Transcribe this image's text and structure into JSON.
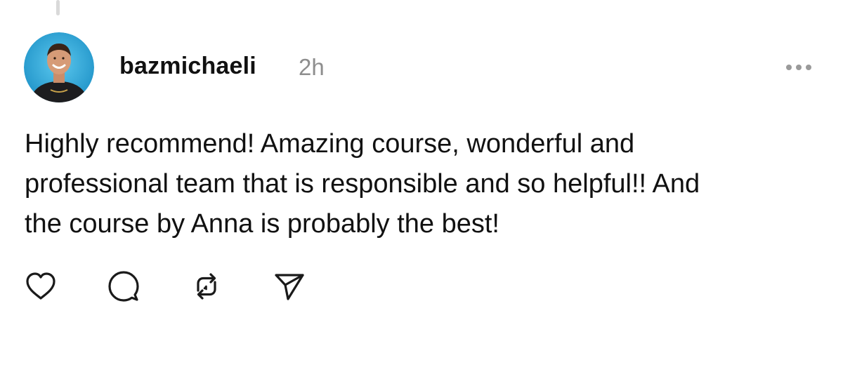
{
  "post": {
    "username": "bazmichaeli",
    "timestamp": "2h",
    "text_lines": [
      "Highly recommend! Amazing course, wonderful and",
      "professional team that is responsible and so helpful!! And",
      "the course by Anna is probably the best!"
    ]
  },
  "icons": {
    "more": "more-horizontal-icon",
    "like": "heart-icon",
    "reply": "comment-bubble-icon",
    "repost": "repost-arrows-icon",
    "share": "send-paper-plane-icon"
  },
  "colors": {
    "text": "#111111",
    "muted": "#8e8e8e",
    "avatar_bg": "#2aa6d9"
  }
}
